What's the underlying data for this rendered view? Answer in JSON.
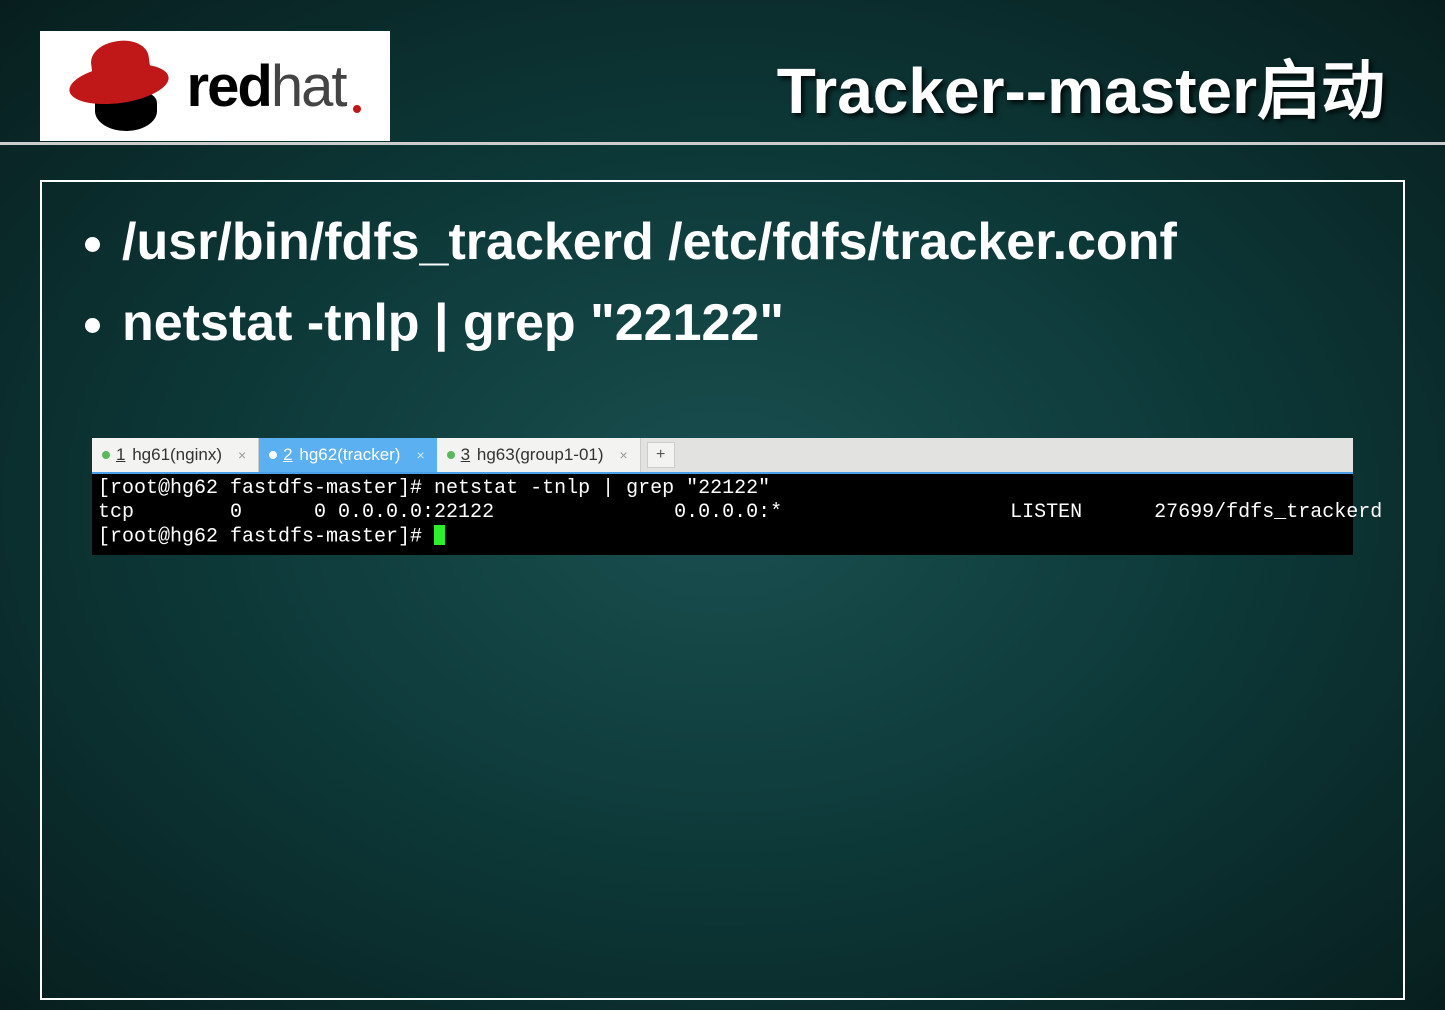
{
  "header": {
    "logo_bold": "red",
    "logo_light": "hat",
    "title": "Tracker--master启动"
  },
  "bullets": [
    "/usr/bin/fdfs_trackerd /etc/fdfs/tracker.conf",
    "netstat -tnlp | grep \"22122\""
  ],
  "terminal": {
    "tabs": [
      {
        "num": "1",
        "label": "hg61(nginx)"
      },
      {
        "num": "2",
        "label": "hg62(tracker)"
      },
      {
        "num": "3",
        "label": "hg63(group1-01)"
      }
    ],
    "active_tab_index": 1,
    "add_label": "+",
    "line1": "[root@hg62 fastdfs-master]# netstat -tnlp | grep \"22122\"",
    "line2": "tcp        0      0 0.0.0.0:22122               0.0.0.0:*                   LISTEN      27699/fdfs_trackerd",
    "line3_prompt": "[root@hg62 fastdfs-master]# "
  }
}
